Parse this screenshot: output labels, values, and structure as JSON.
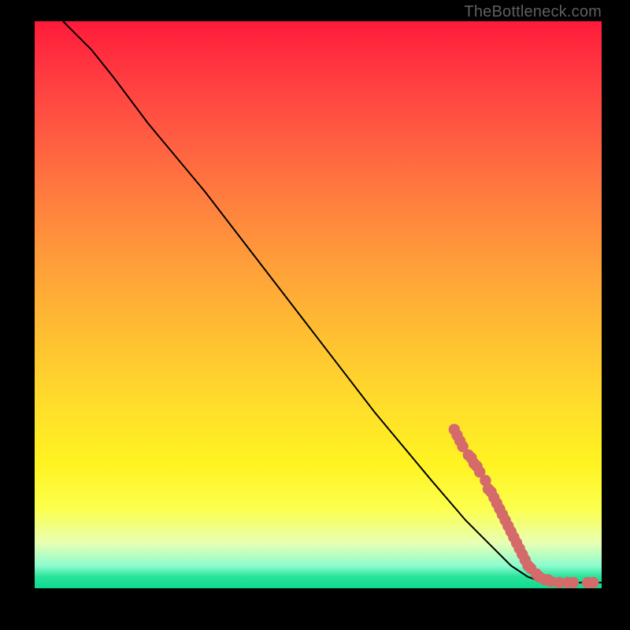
{
  "watermark": "TheBottleneck.com",
  "chart_data": {
    "type": "line",
    "title": "",
    "xlabel": "",
    "ylabel": "",
    "xlim": [
      0,
      100
    ],
    "ylim": [
      0,
      100
    ],
    "grid": false,
    "legend": false,
    "curve_points": [
      {
        "x": 5,
        "y": 100
      },
      {
        "x": 7,
        "y": 98
      },
      {
        "x": 10,
        "y": 95
      },
      {
        "x": 14,
        "y": 90
      },
      {
        "x": 20,
        "y": 82
      },
      {
        "x": 30,
        "y": 70
      },
      {
        "x": 40,
        "y": 57
      },
      {
        "x": 50,
        "y": 44
      },
      {
        "x": 60,
        "y": 31
      },
      {
        "x": 70,
        "y": 19
      },
      {
        "x": 76,
        "y": 12
      },
      {
        "x": 80,
        "y": 8
      },
      {
        "x": 84,
        "y": 4
      },
      {
        "x": 87,
        "y": 2
      },
      {
        "x": 90,
        "y": 1
      },
      {
        "x": 95,
        "y": 1
      },
      {
        "x": 100,
        "y": 1
      }
    ],
    "marker_points": [
      {
        "x": 74,
        "y": 28
      },
      {
        "x": 74.5,
        "y": 27
      },
      {
        "x": 75,
        "y": 26
      },
      {
        "x": 75.5,
        "y": 25
      },
      {
        "x": 76.5,
        "y": 23.5
      },
      {
        "x": 77,
        "y": 23
      },
      {
        "x": 77.5,
        "y": 22
      },
      {
        "x": 78,
        "y": 21.5
      },
      {
        "x": 78.5,
        "y": 20.5
      },
      {
        "x": 79.5,
        "y": 19
      },
      {
        "x": 80,
        "y": 17.5
      },
      {
        "x": 80.5,
        "y": 17
      },
      {
        "x": 81,
        "y": 16
      },
      {
        "x": 81.5,
        "y": 15
      },
      {
        "x": 82,
        "y": 14
      },
      {
        "x": 82.5,
        "y": 13
      },
      {
        "x": 83,
        "y": 12
      },
      {
        "x": 83.5,
        "y": 11
      },
      {
        "x": 84,
        "y": 10
      },
      {
        "x": 84.5,
        "y": 9
      },
      {
        "x": 85,
        "y": 8
      },
      {
        "x": 85.5,
        "y": 7
      },
      {
        "x": 86,
        "y": 6
      },
      {
        "x": 86.5,
        "y": 5
      },
      {
        "x": 87,
        "y": 4
      },
      {
        "x": 87.5,
        "y": 3.5
      },
      {
        "x": 88.5,
        "y": 2.5
      },
      {
        "x": 89,
        "y": 2
      },
      {
        "x": 90,
        "y": 1.5
      },
      {
        "x": 90.5,
        "y": 1.5
      },
      {
        "x": 91,
        "y": 1.2
      },
      {
        "x": 92.5,
        "y": 1
      },
      {
        "x": 94,
        "y": 1
      },
      {
        "x": 95,
        "y": 1
      },
      {
        "x": 97.5,
        "y": 1
      },
      {
        "x": 98.5,
        "y": 1
      }
    ]
  },
  "colors": {
    "marker": "#d46a6a",
    "curve": "#000000"
  }
}
